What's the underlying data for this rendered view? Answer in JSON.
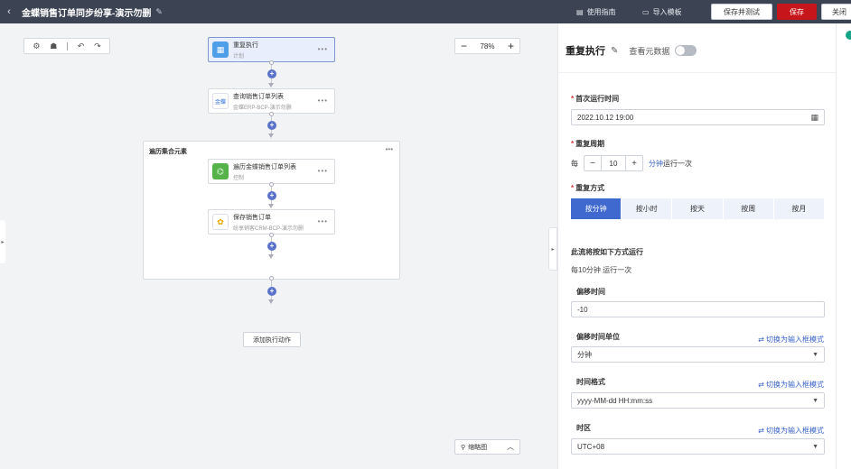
{
  "header": {
    "title": "金蝶销售订单同步纷享-演示勿删",
    "guide_label": "使用指南",
    "import_label": "导入模板",
    "save_test_label": "保存并测试",
    "save_label": "保存",
    "close_label": "关闭"
  },
  "canvas": {
    "zoom": "78%",
    "nodes": [
      {
        "title": "重复执行",
        "subtitle": "计划"
      },
      {
        "title": "查询销售订单列表",
        "subtitle": "金蝶ERP-BCP-演示勿删"
      },
      {
        "title": "遍历金蝶销售订单列表",
        "subtitle": "控制"
      },
      {
        "title": "保存销售订单",
        "subtitle": "纷享销客CRM-BCP-演示勿删"
      }
    ],
    "loop_title": "遍历集合元素",
    "add_action_label": "添加执行动作",
    "minimap_label": "缩略图"
  },
  "panel": {
    "title": "重复执行",
    "meta_label": "查看元数据",
    "first_run_label": "首次运行时间",
    "first_run_value": "2022.10.12 19:00",
    "period_label": "重复周期",
    "every_label": "每",
    "period_value": "10",
    "period_unit": "分钟",
    "period_suffix": "运行一次",
    "mode_label": "重复方式",
    "modes": [
      "按分钟",
      "按小时",
      "按天",
      "按周",
      "按月"
    ],
    "run_title": "此流将按如下方式运行",
    "run_desc": "每10分钟 运行一次",
    "offset_label": "偏移时间",
    "offset_value": "-10",
    "offset_unit_label": "偏移时间单位",
    "offset_unit_value": "分钟",
    "switch_label": "切换为输入框模式",
    "format_label": "时间格式",
    "format_value": "yyyy-MM-dd HH:mm:ss",
    "tz_label": "时区",
    "tz_value": "UTC+08"
  }
}
